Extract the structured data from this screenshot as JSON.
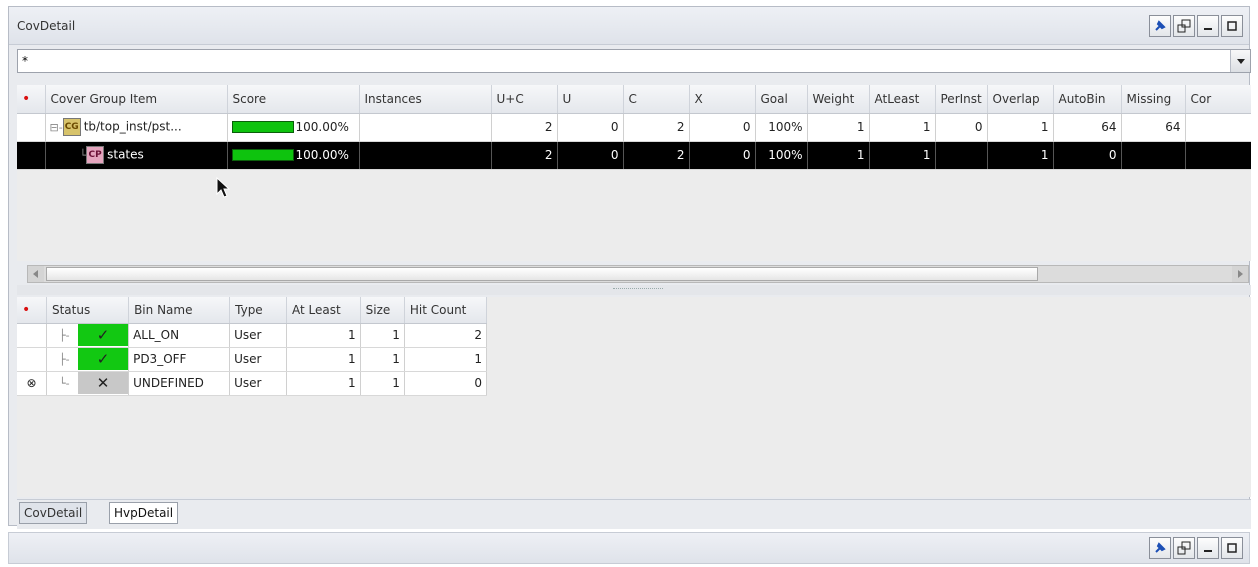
{
  "window": {
    "title": "CovDetail"
  },
  "filter": {
    "value": "*"
  },
  "upper_table": {
    "columns": [
      "",
      "Cover Group Item",
      "Score",
      "Instances",
      "U+C",
      "U",
      "C",
      "X",
      "Goal",
      "Weight",
      "AtLeast",
      "PerInst",
      "Overlap",
      "AutoBin",
      "Missing",
      "Cor"
    ],
    "rows": [
      {
        "badge": "CG",
        "name": "tb/top_inst/pst...",
        "score": "100.00%",
        "instances": "",
        "uc": "2",
        "u": "0",
        "c": "2",
        "x": "0",
        "goal": "100%",
        "weight": "1",
        "atleast": "1",
        "perinst": "0",
        "overlap": "1",
        "autobin": "64",
        "missing": "64",
        "cor": ""
      },
      {
        "badge": "CP",
        "name": "states",
        "score": "100.00%",
        "instances": "",
        "uc": "2",
        "u": "0",
        "c": "2",
        "x": "0",
        "goal": "100%",
        "weight": "1",
        "atleast": "1",
        "perinst": "",
        "overlap": "1",
        "autobin": "0",
        "missing": "",
        "cor": ""
      }
    ]
  },
  "lower_table": {
    "columns": [
      "",
      "Status",
      "Bin Name",
      "Type",
      "At Least",
      "Size",
      "Hit Count"
    ],
    "rows": [
      {
        "status": "covered",
        "mark": "✓",
        "bin": "ALL_ON",
        "type": "User",
        "atleast": "1",
        "size": "1",
        "hit": "2"
      },
      {
        "status": "covered",
        "mark": "✓",
        "bin": "PD3_OFF",
        "type": "User",
        "atleast": "1",
        "size": "1",
        "hit": "1"
      },
      {
        "status": "uncovered",
        "mark": "✕",
        "bin": "UNDEFINED",
        "type": "User",
        "atleast": "1",
        "size": "1",
        "hit": "0"
      }
    ]
  },
  "tabs": [
    "CovDetail",
    "HvpDetail"
  ],
  "colors": {
    "covered": "#12c812",
    "uncovered": "#c8c8c8",
    "selected_row": "#000000"
  },
  "icons": [
    "pin-icon",
    "float-window-icon",
    "minimize-icon",
    "maximize-icon",
    "dropdown-arrow-icon",
    "exclude-icon"
  ]
}
